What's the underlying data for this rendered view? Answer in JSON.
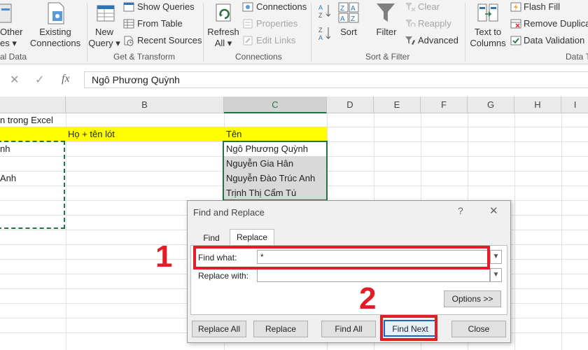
{
  "ribbon": {
    "get_data": {
      "other_line1": "Other",
      "other_line2": "es ▾",
      "group": "al Data"
    },
    "existing_connections": {
      "line1": "Existing",
      "line2": "Connections"
    },
    "new_query": {
      "line1": "New",
      "line2": "Query ▾"
    },
    "show_queries": "Show Queries",
    "from_table": "From Table",
    "recent_sources": "Recent Sources",
    "group_get_transform": "Get & Transform",
    "refresh_all": {
      "line1": "Refresh",
      "line2": "All ▾"
    },
    "connections": "Connections",
    "properties": "Properties",
    "edit_links": "Edit Links",
    "group_connections": "Connections",
    "sort": "Sort",
    "filter": "Filter",
    "clear": "Clear",
    "reapply": "Reapply",
    "advanced": "Advanced",
    "group_sort_filter": "Sort & Filter",
    "text_to_columns": {
      "line1": "Text to",
      "line2": "Columns"
    },
    "flash_fill": "Flash Fill",
    "remove_duplicates": "Remove Duplica",
    "data_validation": "Data Validation",
    "group_data_tools": "Data T"
  },
  "formula_bar": {
    "cancel_symbol": "✕",
    "enter_symbol": "✓",
    "fx_symbol": "fx",
    "content": "Ngô Phương Quỳnh"
  },
  "sheet": {
    "columns": [
      "B",
      "C",
      "D",
      "E",
      "F",
      "G",
      "H",
      "I"
    ],
    "cells": {
      "a1": "n trong Excel",
      "b2": "Họ + tên lót",
      "c2": "Tên",
      "a3": "nh",
      "a5": "Anh",
      "c3": "Ngô Phương Quỳnh",
      "c4": "Nguyễn Gia Hân",
      "c5": "Nguyễn Đào Trúc Anh",
      "c6": "Trịnh Thị Cẩm Tú"
    }
  },
  "dialog": {
    "title": "Find and Replace",
    "help": "?",
    "close": "✕",
    "tabs": [
      "Find",
      "Replace"
    ],
    "active_tab": "Replace",
    "find_what_label": "Find what:",
    "find_what_value": "*",
    "replace_with_label": "Replace with:",
    "replace_with_value": "",
    "options_button": "Options >>",
    "buttons": {
      "replace_all": "Replace All",
      "replace": "Replace",
      "find_all": "Find All",
      "find_next": "Find Next",
      "close": "Close"
    }
  },
  "annotations": {
    "step1": "1",
    "step2": "2"
  },
  "colors": {
    "highlight_yellow": "#ffff00",
    "annotation_red": "#e11d27",
    "excel_green": "#217346",
    "selection_gray": "#d9d9d9"
  },
  "icons": [
    "get-data-icon",
    "existing-connections-icon",
    "new-query-icon",
    "show-queries-icon",
    "from-table-icon",
    "recent-sources-icon",
    "refresh-icon",
    "connections-icon",
    "properties-icon",
    "edit-links-icon",
    "sort-az-icon",
    "sort-za-icon",
    "sort-icon",
    "filter-icon",
    "clear-icon",
    "reapply-icon",
    "advanced-icon",
    "text-to-columns-icon",
    "flash-fill-icon",
    "remove-duplicates-icon",
    "data-validation-icon"
  ]
}
